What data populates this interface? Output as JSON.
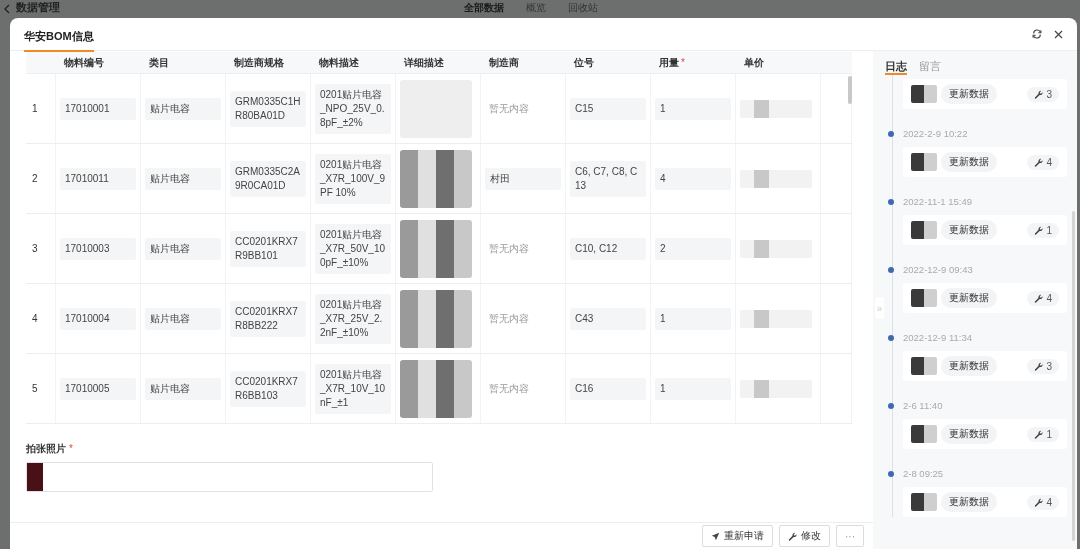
{
  "background": {
    "title": "数据管理",
    "tabs": [
      {
        "label": "全部数据",
        "selected": true
      },
      {
        "label": "概览",
        "selected": false
      },
      {
        "label": "回收站",
        "selected": false
      }
    ]
  },
  "dialog": {
    "title": "华安BOM信息"
  },
  "table": {
    "columns": [
      {
        "label": "物料编号"
      },
      {
        "label": "类目"
      },
      {
        "label": "制造商规格"
      },
      {
        "label": "物料描述"
      },
      {
        "label": "详细描述"
      },
      {
        "label": "制造商"
      },
      {
        "label": "位号"
      },
      {
        "label": "用量",
        "required_mark": "*"
      },
      {
        "label": "单价"
      }
    ],
    "rows": [
      {
        "index": "1",
        "code": "17010001",
        "category": "贴片电容",
        "spec": "GRM0335C1HR80BA01D",
        "description": "0201贴片电容_NPO_25V_0.8pF_±2%",
        "manufacturer": {
          "placeholder": "暂无内容"
        },
        "position": "C15",
        "quantity": "1"
      },
      {
        "index": "2",
        "code": "17010011",
        "category": "贴片电容",
        "spec": "GRM0335C2A9R0CA01D",
        "description": "0201贴片电容_X7R_100V_9PF 10%",
        "manufacturer": {
          "value": "村田"
        },
        "position": "C6, C7, C8, C13",
        "quantity": "4"
      },
      {
        "index": "3",
        "code": "17010003",
        "category": "贴片电容",
        "spec": "CC0201KRX7R9BB101",
        "description": "0201贴片电容_X7R_50V_100pF_±10%",
        "manufacturer": {
          "placeholder": "暂无内容"
        },
        "position": "C10, C12",
        "quantity": "2"
      },
      {
        "index": "4",
        "code": "17010004",
        "category": "贴片电容",
        "spec": "CC0201KRX7R8BB222",
        "description": "0201贴片电容_X7R_25V_2.2nF_±10%",
        "manufacturer": {
          "placeholder": "暂无内容"
        },
        "position": "C43",
        "quantity": "1"
      },
      {
        "index": "5",
        "code": "17010005",
        "category": "贴片电容",
        "spec": "CC0201KRX7R6BB103",
        "description": "0201贴片电容_X7R_10V_10nF_±1",
        "manufacturer": {
          "placeholder": "暂无内容"
        },
        "position": "C16",
        "quantity": "1"
      }
    ]
  },
  "photo_field": {
    "label": "拍张照片",
    "required_mark": "*"
  },
  "footer": {
    "buttons": [
      {
        "label": "重新申请",
        "kind": "resubmit"
      },
      {
        "label": "修改",
        "kind": "edit"
      }
    ],
    "more_button": "···"
  },
  "log_panel": {
    "collapse_handle": "»",
    "tabs": [
      {
        "label": "日志",
        "selected": true
      },
      {
        "label": "留言",
        "selected": false
      }
    ],
    "entries": [
      {
        "action": "更新数据",
        "count": "3"
      },
      {
        "time": "2022-2-9 10:22",
        "action": "更新数据",
        "count": "4"
      },
      {
        "time": "2022-11-1 15:49",
        "action": "更新数据",
        "count": "1"
      },
      {
        "time": "2022-12-9 09:43",
        "action": "更新数据",
        "count": "4"
      },
      {
        "time": "2022-12-9 11:34",
        "action": "更新数据",
        "count": "3"
      },
      {
        "time": "2-6 11:40",
        "action": "更新数据",
        "count": "1"
      },
      {
        "time": "2-8 09:25",
        "action": "更新数据",
        "count": "4"
      }
    ]
  }
}
